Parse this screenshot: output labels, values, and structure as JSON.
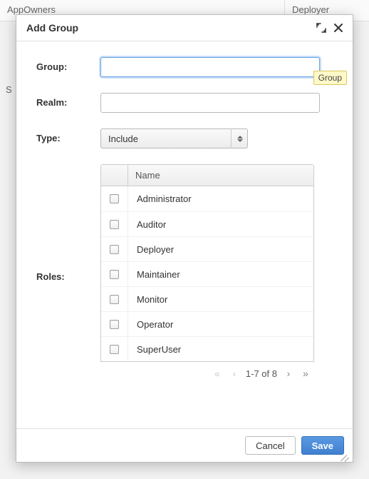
{
  "background": {
    "col1": "AppOwners",
    "col2": "Deployer",
    "truncated": "S"
  },
  "modal": {
    "title": "Add Group",
    "tooltip": "Group",
    "labels": {
      "group": "Group:",
      "realm": "Realm:",
      "type": "Type:",
      "roles": "Roles:"
    },
    "fields": {
      "group_value": "",
      "realm_value": "",
      "type_value": "Include"
    },
    "roles": {
      "header_name": "Name",
      "items": [
        {
          "label": "Administrator"
        },
        {
          "label": "Auditor"
        },
        {
          "label": "Deployer"
        },
        {
          "label": "Maintainer"
        },
        {
          "label": "Monitor"
        },
        {
          "label": "Operator"
        },
        {
          "label": "SuperUser"
        }
      ],
      "pager_text": "1-7 of 8"
    },
    "buttons": {
      "cancel": "Cancel",
      "save": "Save"
    }
  }
}
